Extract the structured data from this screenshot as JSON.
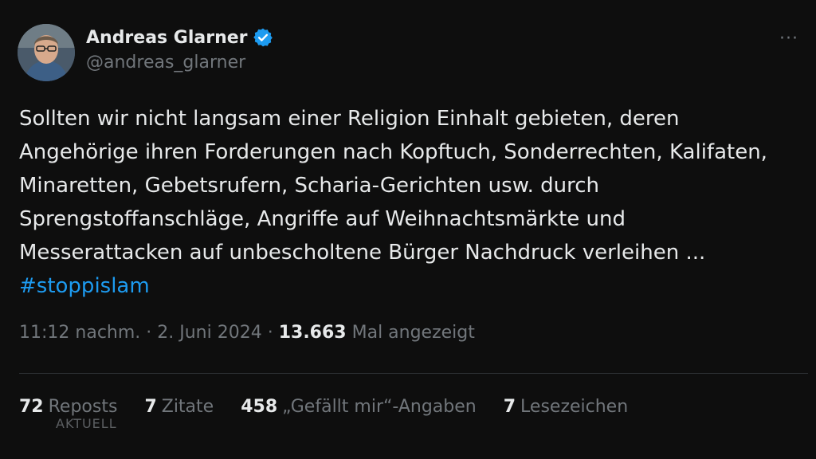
{
  "user": {
    "display_name": "Andreas Glarner",
    "handle": "@andreas_glarner",
    "verified": true,
    "avatar_icon": "profile-photo"
  },
  "more_label": "···",
  "tweet": {
    "lines": [
      "Sollten wir nicht langsam einer Religion Einhalt gebieten, deren",
      "Angehörige ihren Forderungen nach Kopftuch, Sonderrechten, Kalifaten,",
      "Minaretten, Gebetsrufern, Scharia-Gerichten usw.  durch",
      "Sprengstoffanschläge, Angriffe auf Weihnachtsmärkte und",
      "Messerattacken auf unbescholtene Bürger Nachdruck verleihen ..."
    ],
    "hashtag": "#stoppislam"
  },
  "meta": {
    "time": "11:12 nachm.",
    "sep1": " · ",
    "date": "2. Juni 2024",
    "sep2": " · ",
    "views": "13.663",
    "views_label": " Mal angezeigt"
  },
  "stats": {
    "reposts": {
      "num": "72",
      "label": "Reposts"
    },
    "quotes": {
      "num": "7",
      "label": "Zitate"
    },
    "likes": {
      "num": "458",
      "label": "„Gefällt mir“-Angaben"
    },
    "bookmarks": {
      "num": "7",
      "label": "Lesezeichen"
    }
  },
  "watermark": "AKTUELL",
  "colors": {
    "background": "#0e0e0e",
    "text": "#e7e9ea",
    "muted": "#71767b",
    "link": "#1d9bf0",
    "verified": "#1d9bf0"
  }
}
